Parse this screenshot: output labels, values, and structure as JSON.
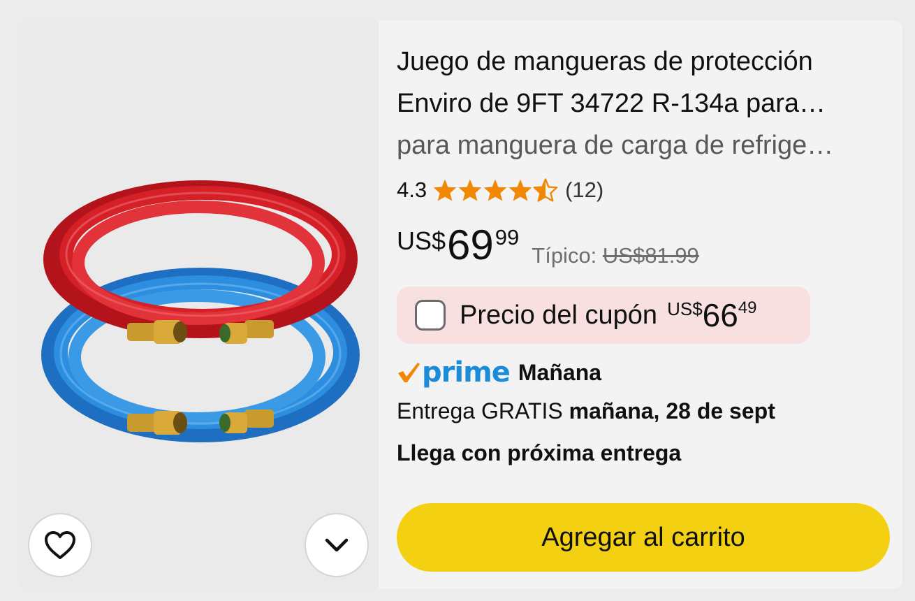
{
  "product": {
    "title_line1": "Juego de mangueras de protección",
    "title_line2": "Enviro de 9FT 34722 R-134a para…",
    "subtitle": "para manguera de carga de refrige…",
    "rating_value": "4.3",
    "rating_stars": 4.3,
    "rating_count": "(12)",
    "image_alt": "Red and blue refrigerant charging hoses with brass fittings"
  },
  "price": {
    "currency": "US$",
    "whole": "69",
    "fraction": "99",
    "typical_label": "Típico:",
    "typical_price": "US$81.99"
  },
  "coupon": {
    "label": "Precio del cupón",
    "currency": "US$",
    "whole": "66",
    "fraction": "49",
    "checked": false
  },
  "delivery": {
    "prime_label": "prime",
    "prime_day": "Mañana",
    "line_prefix": "Entrega GRATIS",
    "line_date": "mañana, 28 de sept",
    "arrives": "Llega con próxima entrega"
  },
  "actions": {
    "add_to_cart": "Agregar al carrito",
    "favorite_icon": "heart-icon",
    "more_icon": "chevron-down-icon"
  },
  "colors": {
    "prime_blue": "#1a8cd8",
    "prime_check": "#f08804",
    "star": "#f08804",
    "cart_button": "#f4d013",
    "coupon_bg": "#f8dfe0"
  }
}
